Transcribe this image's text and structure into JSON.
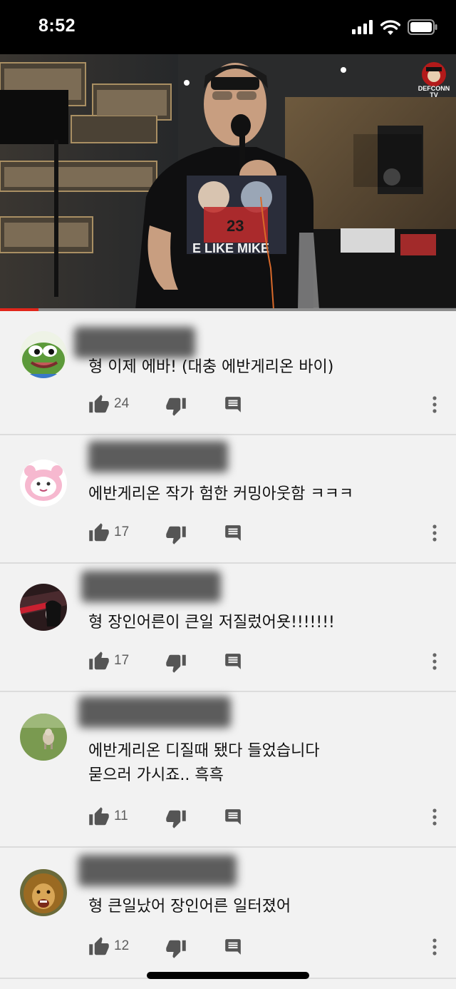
{
  "status_bar": {
    "time": "8:52",
    "icons": [
      "cellular-signal-icon",
      "wifi-icon",
      "battery-icon"
    ]
  },
  "video": {
    "channel_logo": "DEFCONN TV",
    "progress": 0.085,
    "colors": {
      "progress": "#e1261b"
    }
  },
  "comments": [
    {
      "avatar": "pepe-frog-avatar",
      "author_blurred": true,
      "text": [
        "형 이제 에바! (대충 에반게리온 바이)"
      ],
      "likes": "24"
    },
    {
      "avatar": "pink-character-avatar",
      "author_blurred": true,
      "text": [
        "에반게리온 작가 험한 커밍아웃함 ㅋㅋㅋ"
      ],
      "likes": "17"
    },
    {
      "avatar": "anime-character-avatar",
      "author_blurred": true,
      "text": [
        "형 장인어른이 큰일 저질렀어욧!!!!!!!"
      ],
      "likes": "17"
    },
    {
      "avatar": "animal-photo-avatar",
      "author_blurred": true,
      "text": [
        "에반게리온 디질때 됐다 들었습니다",
        "묻으러 가시죠.. 흑흑"
      ],
      "likes": "11"
    },
    {
      "avatar": "lion-avatar",
      "author_blurred": true,
      "text": [
        "형 큰일났어 장인어른 일터졌어"
      ],
      "likes": "12"
    }
  ]
}
